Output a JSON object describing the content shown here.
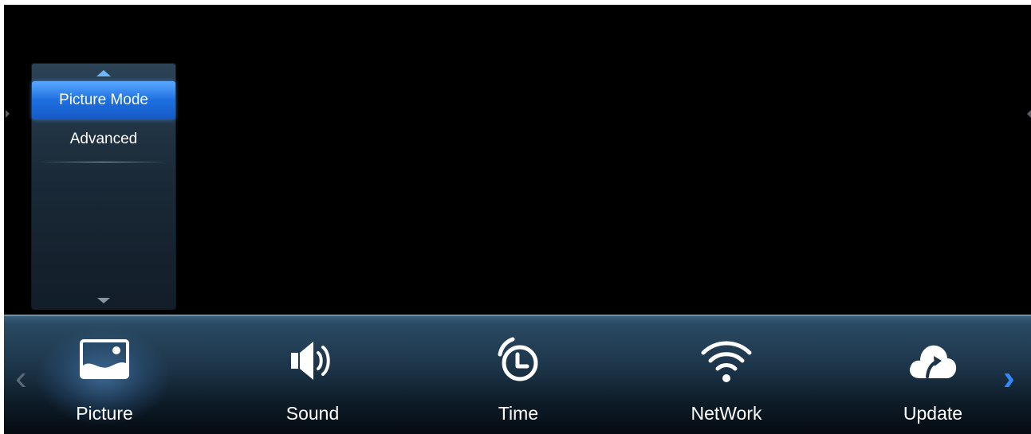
{
  "submenu": {
    "items": [
      {
        "label": "Picture Mode",
        "selected": true
      },
      {
        "label": "Advanced",
        "selected": false
      }
    ]
  },
  "tabs": [
    {
      "label": "Picture",
      "icon": "picture-icon",
      "selected": true
    },
    {
      "label": "Sound",
      "icon": "speaker-icon",
      "selected": false
    },
    {
      "label": "Time",
      "icon": "clock-icon",
      "selected": false
    },
    {
      "label": "NetWork",
      "icon": "wifi-icon",
      "selected": false
    },
    {
      "label": "Update",
      "icon": "cloud-upload-icon",
      "selected": false
    }
  ],
  "navigation": {
    "prev": "‹",
    "next": "›"
  },
  "colors": {
    "accent": "#2f8bff",
    "selected_item": "#1d6fe0",
    "background": "#000000"
  }
}
